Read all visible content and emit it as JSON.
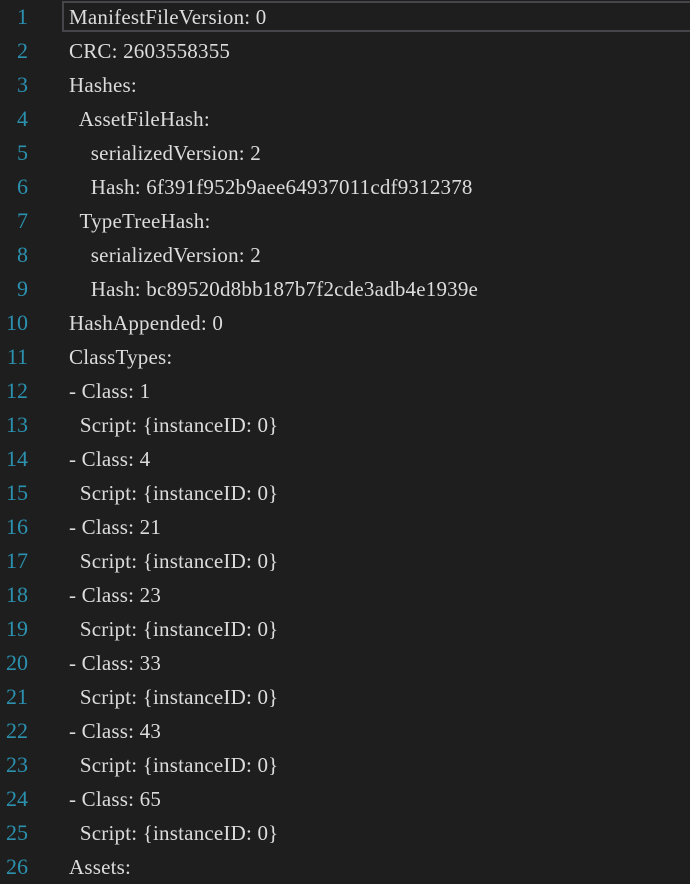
{
  "editor": {
    "lines": [
      {
        "number": "1",
        "text": "ManifestFileVersion: 0"
      },
      {
        "number": "2",
        "text": "CRC: 2603558355"
      },
      {
        "number": "3",
        "text": "Hashes:"
      },
      {
        "number": "4",
        "text": "  AssetFileHash:"
      },
      {
        "number": "5",
        "text": "    serializedVersion: 2"
      },
      {
        "number": "6",
        "text": "    Hash: 6f391f952b9aee64937011cdf9312378"
      },
      {
        "number": "7",
        "text": "  TypeTreeHash:"
      },
      {
        "number": "8",
        "text": "    serializedVersion: 2"
      },
      {
        "number": "9",
        "text": "    Hash: bc89520d8bb187b7f2cde3adb4e1939e"
      },
      {
        "number": "10",
        "text": "HashAppended: 0"
      },
      {
        "number": "11",
        "text": "ClassTypes:"
      },
      {
        "number": "12",
        "text": "- Class: 1"
      },
      {
        "number": "13",
        "text": "  Script: {instanceID: 0}"
      },
      {
        "number": "14",
        "text": "- Class: 4"
      },
      {
        "number": "15",
        "text": "  Script: {instanceID: 0}"
      },
      {
        "number": "16",
        "text": "- Class: 21"
      },
      {
        "number": "17",
        "text": "  Script: {instanceID: 0}"
      },
      {
        "number": "18",
        "text": "- Class: 23"
      },
      {
        "number": "19",
        "text": "  Script: {instanceID: 0}"
      },
      {
        "number": "20",
        "text": "- Class: 33"
      },
      {
        "number": "21",
        "text": "  Script: {instanceID: 0}"
      },
      {
        "number": "22",
        "text": "- Class: 43"
      },
      {
        "number": "23",
        "text": "  Script: {instanceID: 0}"
      },
      {
        "number": "24",
        "text": "- Class: 65"
      },
      {
        "number": "25",
        "text": "  Script: {instanceID: 0}"
      },
      {
        "number": "26",
        "text": "Assets:"
      }
    ]
  },
  "colors": {
    "background": "#1e1e1e",
    "line_number": "#2b91af",
    "code_text": "#dcdcdc",
    "current_line_border": "#46464a"
  }
}
